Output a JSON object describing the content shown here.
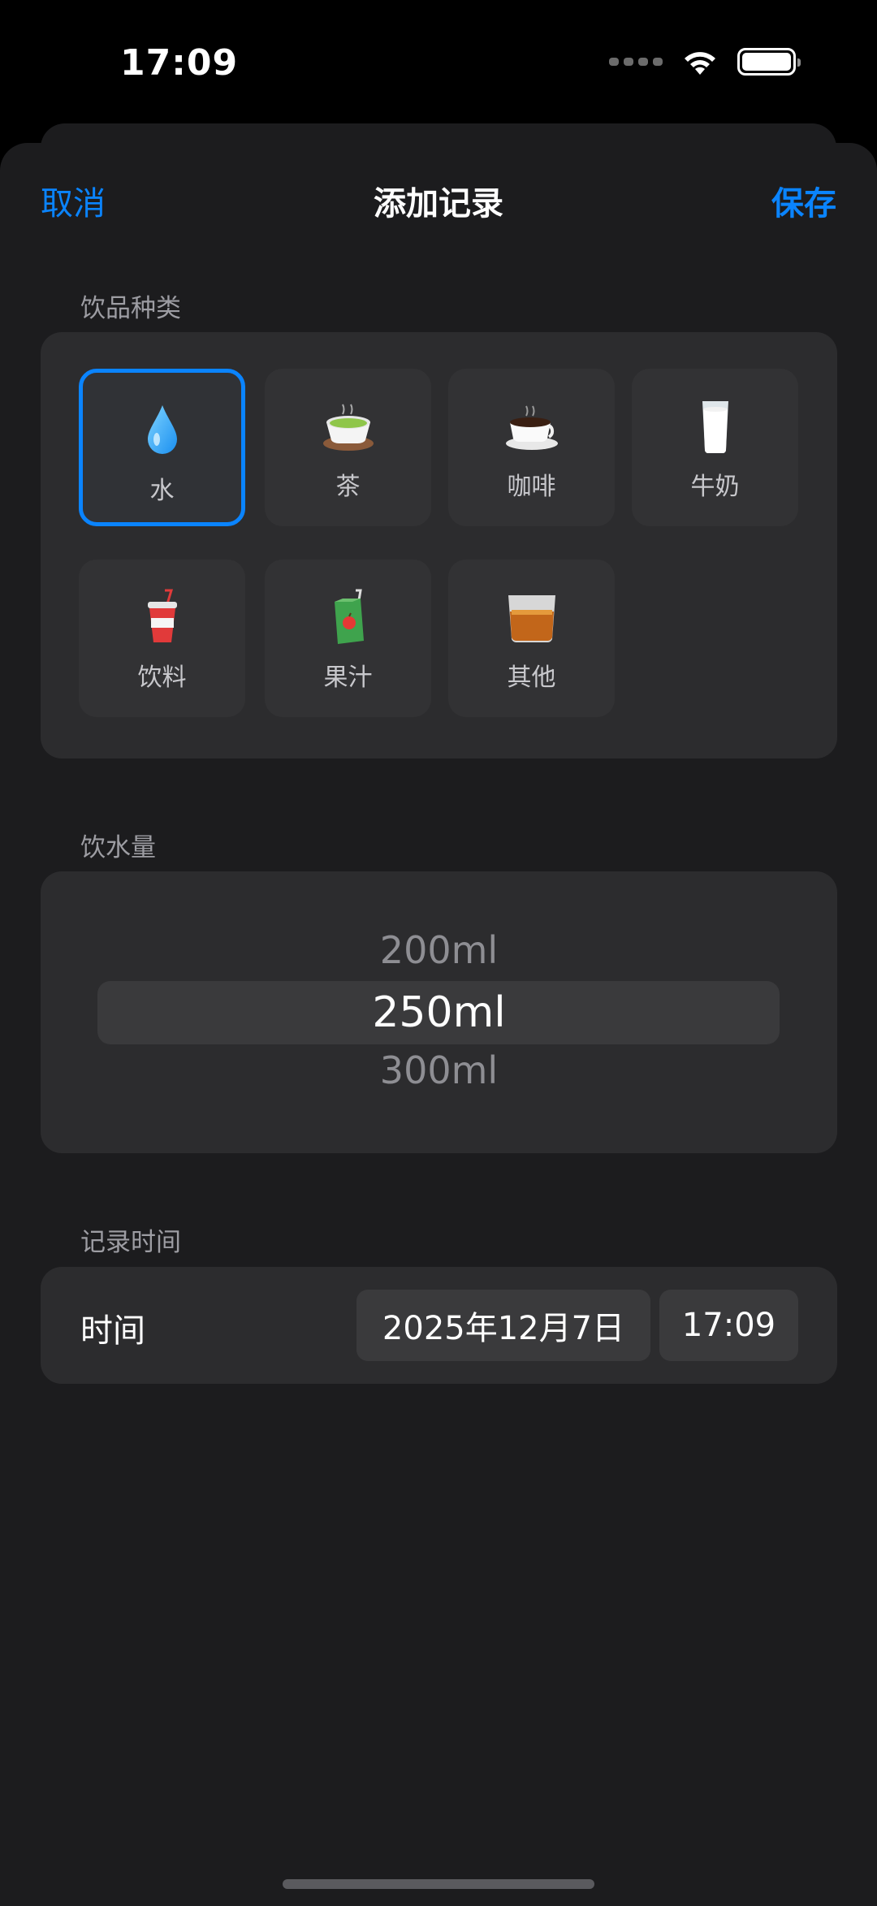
{
  "status_bar": {
    "time": "17:09"
  },
  "nav": {
    "cancel": "取消",
    "title": "添加记录",
    "save": "保存"
  },
  "drink_section": {
    "label": "饮品种类",
    "items": [
      {
        "label": "水",
        "icon": "water-drop-icon",
        "selected": true
      },
      {
        "label": "茶",
        "icon": "tea-icon",
        "selected": false
      },
      {
        "label": "咖啡",
        "icon": "coffee-icon",
        "selected": false
      },
      {
        "label": "牛奶",
        "icon": "milk-icon",
        "selected": false
      },
      {
        "label": "饮料",
        "icon": "soda-cup-icon",
        "selected": false
      },
      {
        "label": "果汁",
        "icon": "juice-box-icon",
        "selected": false
      },
      {
        "label": "其他",
        "icon": "whisky-glass-icon",
        "selected": false
      }
    ]
  },
  "amount_section": {
    "label": "饮水量",
    "options": [
      "200ml",
      "250ml",
      "300ml"
    ],
    "selected": "250ml"
  },
  "time_section": {
    "label": "记录时间",
    "row_label": "时间",
    "date": "2025年12月7日",
    "time": "17:09"
  },
  "colors": {
    "accent": "#0a84ff",
    "background": "#1c1c1e",
    "card": "#2c2c2e"
  }
}
